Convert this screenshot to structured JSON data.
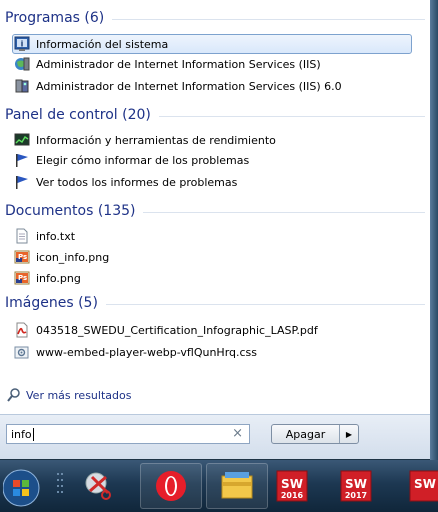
{
  "groups": [
    {
      "title": "Programas (6)",
      "items": [
        {
          "label": "Información del sistema",
          "icon": "system-info-icon"
        },
        {
          "label": "Administrador de Internet Information Services (IIS)",
          "icon": "iis-manager-icon"
        },
        {
          "label": "Administrador de Internet Information Services (IIS) 6.0",
          "icon": "iis6-manager-icon"
        }
      ]
    },
    {
      "title": "Panel de control (20)",
      "items": [
        {
          "label": "Información y herramientas de rendimiento",
          "icon": "performance-icon"
        },
        {
          "label": "Elegir cómo informar de los problemas",
          "icon": "flag-icon"
        },
        {
          "label": "Ver todos los informes de problemas",
          "icon": "flag-icon"
        }
      ]
    },
    {
      "title": "Documentos (135)",
      "items": [
        {
          "label": "info.txt",
          "icon": "text-file-icon"
        },
        {
          "label": "icon_info.png",
          "icon": "image-file-icon"
        },
        {
          "label": "info.png",
          "icon": "image-file-icon"
        }
      ]
    },
    {
      "title": "Imágenes (5)",
      "items": [
        {
          "label": "043518_SWEDU_Certification_Infographic_LASP.pdf",
          "icon": "pdf-file-icon"
        },
        {
          "label": "www-embed-player-webp-vflQunHrq.css",
          "icon": "css-file-icon"
        }
      ]
    }
  ],
  "more_results": "Ver más resultados",
  "search": {
    "value": "info",
    "clear": "×"
  },
  "shutdown": {
    "label": "Apagar",
    "arrow": "▶"
  },
  "taskbar": {
    "start": "start-orb-icon",
    "apps": [
      {
        "name": "snipping-tool-icon"
      },
      {
        "name": "opera-icon"
      },
      {
        "name": "file-explorer-icon"
      },
      {
        "name": "solidworks-2016-icon",
        "label": "2016"
      },
      {
        "name": "solidworks-2017-icon",
        "label": "2017"
      },
      {
        "name": "solidworks-icon",
        "label": ""
      }
    ]
  },
  "colors": {
    "header": "#1e3287",
    "selection_border": "#7da2ce",
    "taskbar": "#1d3852"
  }
}
